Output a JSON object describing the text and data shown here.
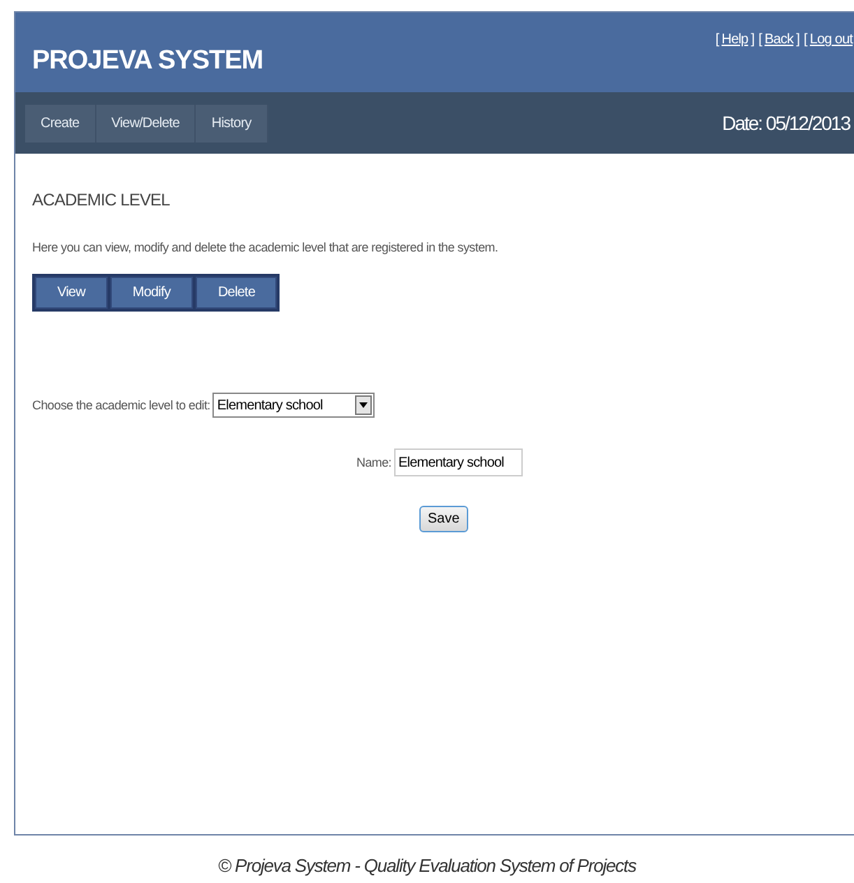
{
  "header": {
    "title": "PROJEVA SYSTEM",
    "links": [
      {
        "kind": "bracket",
        "text": "["
      },
      {
        "kind": "link",
        "text": "Help"
      },
      {
        "kind": "bracket",
        "text": "]"
      },
      {
        "kind": "bracket",
        "text": "["
      },
      {
        "kind": "link",
        "text": "Back"
      },
      {
        "kind": "bracket",
        "text": "]"
      },
      {
        "kind": "bracket",
        "text": "["
      },
      {
        "kind": "link",
        "text": "Log out"
      }
    ]
  },
  "nav": {
    "items": [
      "Create",
      "View/Delete",
      "History"
    ],
    "date": "Date: 05/12/2013"
  },
  "page": {
    "heading": "ACADEMIC LEVEL",
    "description": "Here you can view, modify and delete the academic level that are registered in the system.",
    "tabs": [
      {
        "label": "View"
      },
      {
        "label": "Modify"
      },
      {
        "label": "Delete"
      }
    ],
    "select_label": "Choose the academic level to edit:",
    "select_value": "Elementary school",
    "name_label": "Name:",
    "name_value": "Elementary school",
    "save": "Save"
  },
  "footer": "© Projeva System - Quality Evaluation System of Projects"
}
